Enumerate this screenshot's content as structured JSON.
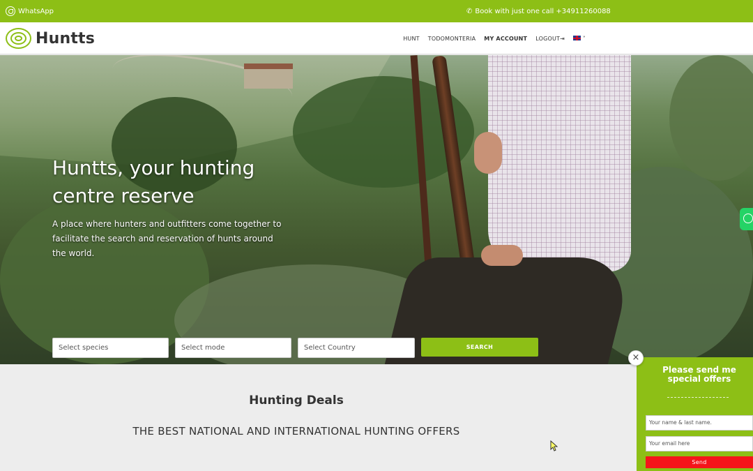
{
  "topbar": {
    "whatsapp_label": "WhatsApp",
    "booking_text": "Book with just one call +34911260088",
    "phone_icon": "phone-icon",
    "whatsapp_icon": "whatsapp-icon",
    "bg_color": "#8dbf16"
  },
  "header": {
    "logo_text": "Huntts",
    "nav": {
      "hunt": "HUNT",
      "todomonteria": "TODOMONTERIA",
      "my_account": "MY ACCOUNT",
      "logout": "LOGOUT",
      "lang_icon": "uk-flag-icon",
      "chevron": "˅"
    }
  },
  "hero": {
    "title": "Huntts, your hunting centre reserve",
    "subtitle": "A place where hunters and outfitters come together to facilitate the search and reservation of hunts around the world.",
    "search": {
      "species_placeholder": "Select species",
      "mode_placeholder": "Select mode",
      "country_placeholder": "Select Country",
      "button_label": "SEARCH"
    }
  },
  "deals": {
    "title": "Hunting Deals",
    "subtitle": "THE BEST NATIONAL AND INTERNATIONAL HUNTING OFFERS"
  },
  "offer_popup": {
    "close_label": "×",
    "title": "Please send me special offers",
    "name_placeholder": "Your name & last name.",
    "email_placeholder": "Your email here",
    "send_label": "Send",
    "accent_color": "#f5141a"
  }
}
